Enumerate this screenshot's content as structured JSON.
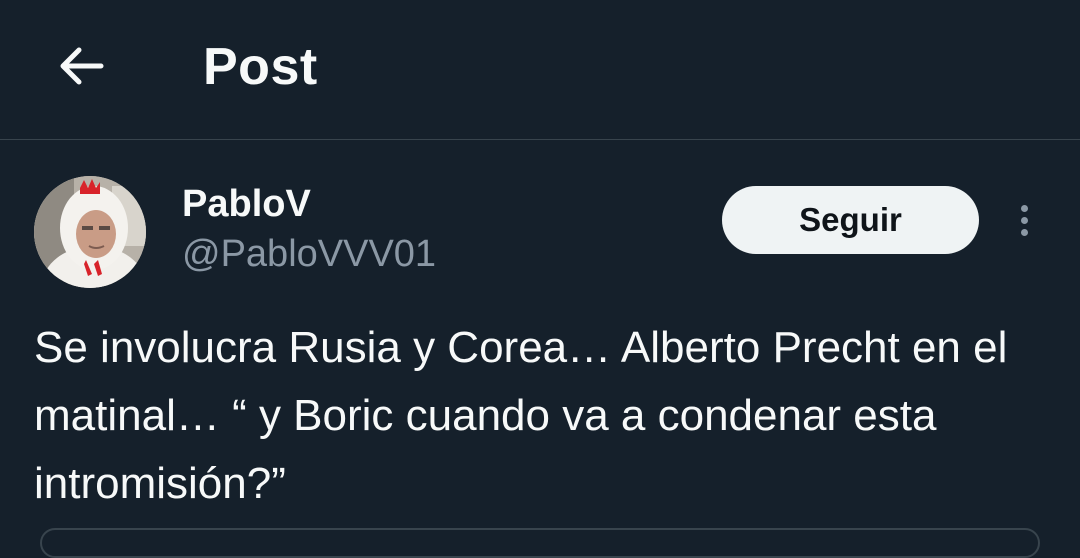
{
  "header": {
    "back_icon": "arrow-left-icon",
    "title": "Post"
  },
  "author": {
    "display_name": "PabloV",
    "handle": "@PabloVVV01",
    "avatar_icon": "person-in-chicken-costume-avatar"
  },
  "actions": {
    "follow_label": "Seguir",
    "more_icon": "vertical-ellipsis-icon"
  },
  "post": {
    "text": "Se involucra Rusia y Corea… Alberto Precht en el matinal… “ y Boric cuando va a condenar esta intromisión?”"
  },
  "colors": {
    "background": "#15202b",
    "divider": "#38444d",
    "text_primary": "#f7f9f9",
    "text_secondary": "#8b98a5",
    "button_bg": "#eff3f4",
    "button_text": "#0f1419"
  }
}
